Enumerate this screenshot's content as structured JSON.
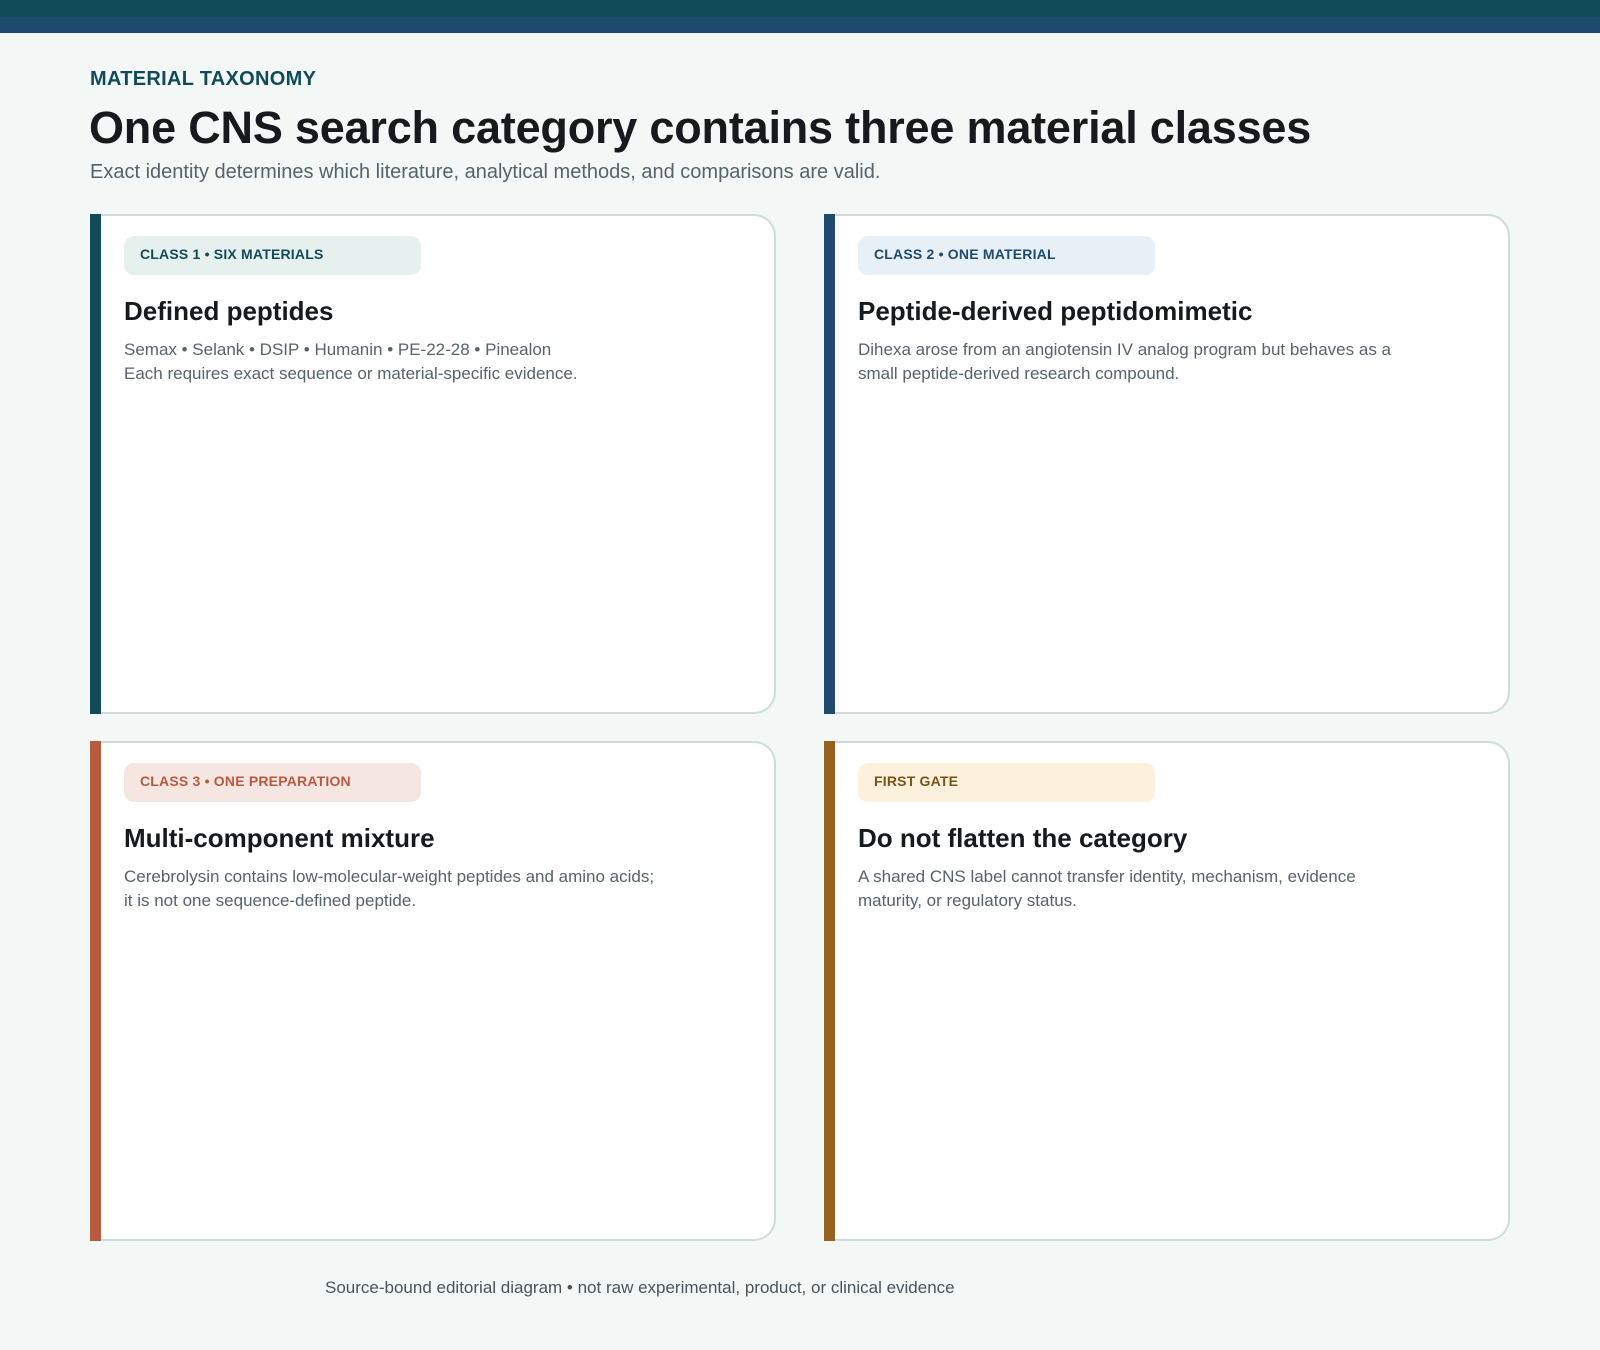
{
  "header": {
    "eyebrow": "MATERIAL TAXONOMY",
    "title": "One CNS search category contains three material classes",
    "subtitle": "Exact identity determines which literature, analytical methods, and comparisons are valid."
  },
  "colors": {
    "class1": "#114b58",
    "class2": "#1e4a6e",
    "class3": "#b85a40",
    "gate": "#956221"
  },
  "cards": [
    {
      "badge": "CLASS 1 • SIX MATERIALS",
      "heading": "Defined peptides",
      "line1": "Semax • Selank • DSIP • Humanin • PE-22-28 • Pinealon",
      "line2": "Each requires exact sequence or material-specific evidence."
    },
    {
      "badge": "CLASS 2 • ONE MATERIAL",
      "heading": "Peptide-derived peptidomimetic",
      "text": "Dihexa arose from an angiotensin IV analog program but behaves as a small peptide-derived research compound."
    },
    {
      "badge": "CLASS 3 • ONE PREPARATION",
      "heading": "Multi-component mixture",
      "text": "Cerebrolysin contains low-molecular-weight peptides and amino acids; it is not one sequence-defined peptide."
    },
    {
      "badge": "FIRST GATE",
      "heading": "Do not flatten the category",
      "text": "A shared CNS label cannot transfer identity, mechanism, evidence maturity, or regulatory status."
    }
  ],
  "footer": "Source-bound editorial diagram • not raw experimental, product, or clinical evidence"
}
